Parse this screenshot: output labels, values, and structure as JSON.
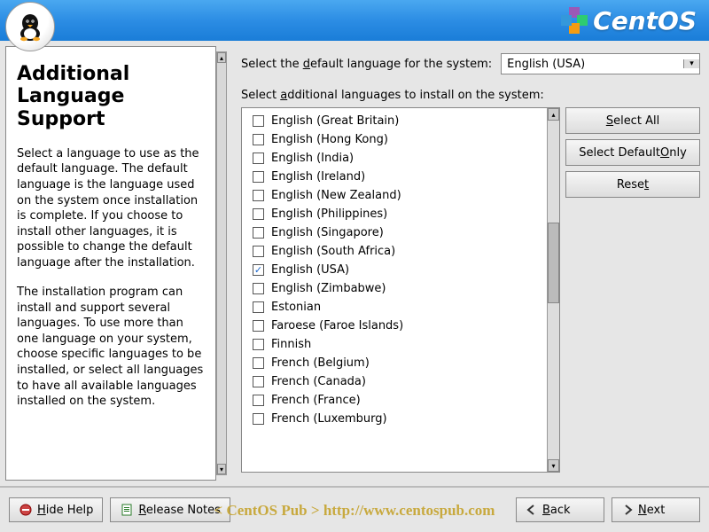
{
  "brand": "CentOS",
  "help": {
    "title": "Additional Language Support",
    "p1": "Select a language to use as the default language. The default language is the language used on the system once installation is complete. If you choose to install other languages, it is possible to change the default language after the installation.",
    "p2": "The installation program can install and support several languages. To use more than one language on your system, choose specific languages to be installed, or select all languages to have all available languages installed on the system."
  },
  "labels": {
    "select_default_pre": "Select the ",
    "select_default_u": "d",
    "select_default_post": "efault language for the system:",
    "select_additional_pre": "Select ",
    "select_additional_u": "a",
    "select_additional_post": "dditional languages to install on the system:"
  },
  "default_language": "English (USA)",
  "buttons": {
    "select_all_pre": "",
    "select_all_u": "S",
    "select_all_post": "elect All",
    "select_default_only_pre": "Select Default ",
    "select_default_only_u": "O",
    "select_default_only_post": "nly",
    "reset_pre": "Rese",
    "reset_u": "t",
    "reset_post": ""
  },
  "footer": {
    "hide_help_u": "H",
    "hide_help_post": "ide Help",
    "release_notes_u": "R",
    "release_notes_post": "elease Notes",
    "back_u": "B",
    "back_post": "ack",
    "next_u": "N",
    "next_post": "ext"
  },
  "watermark": "< CentOS Pub > http://www.centospub.com",
  "languages": [
    {
      "label": "English (Great Britain)",
      "checked": false
    },
    {
      "label": "English (Hong Kong)",
      "checked": false
    },
    {
      "label": "English (India)",
      "checked": false
    },
    {
      "label": "English (Ireland)",
      "checked": false
    },
    {
      "label": "English (New Zealand)",
      "checked": false
    },
    {
      "label": "English (Philippines)",
      "checked": false
    },
    {
      "label": "English (Singapore)",
      "checked": false
    },
    {
      "label": "English (South Africa)",
      "checked": false
    },
    {
      "label": "English (USA)",
      "checked": true
    },
    {
      "label": "English (Zimbabwe)",
      "checked": false
    },
    {
      "label": "Estonian",
      "checked": false
    },
    {
      "label": "Faroese (Faroe Islands)",
      "checked": false
    },
    {
      "label": "Finnish",
      "checked": false
    },
    {
      "label": "French (Belgium)",
      "checked": false
    },
    {
      "label": "French (Canada)",
      "checked": false
    },
    {
      "label": "French (France)",
      "checked": false
    },
    {
      "label": "French (Luxemburg)",
      "checked": false
    }
  ]
}
